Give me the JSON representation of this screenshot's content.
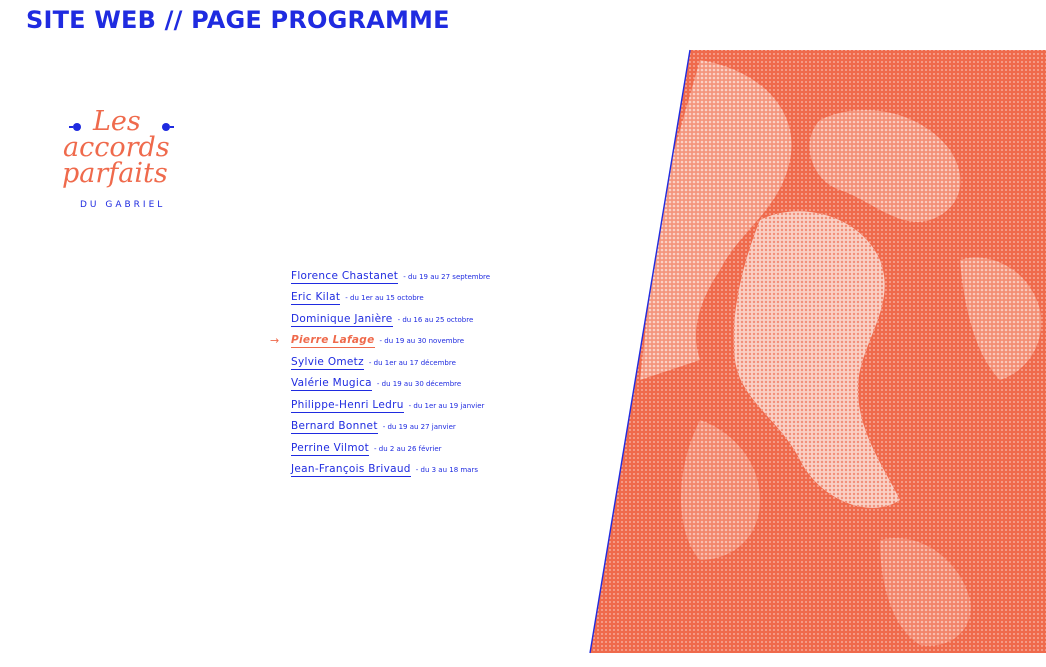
{
  "header": {
    "title": "SITE WEB // PAGE PROGRAMME"
  },
  "logo": {
    "line1": "Les",
    "line2": "accords",
    "line3": "parfaits",
    "subtitle": "DU GABRIEL"
  },
  "program": {
    "arrow": "→",
    "items": [
      {
        "name": "Florence Chastanet",
        "dates": "- du 19 au 27 septembre"
      },
      {
        "name": "Eric Kilat",
        "dates": "- du 1er au 15 octobre"
      },
      {
        "name": "Dominique Janière",
        "dates": "- du 16 au 25 octobre"
      },
      {
        "name": "Pierre Lafage",
        "dates": "- du 19 au 30 novembre"
      },
      {
        "name": "Sylvie Ometz",
        "dates": "- du 1er au 17 décembre"
      },
      {
        "name": "Valérie Mugica",
        "dates": "- du 19 au 30 décembre"
      },
      {
        "name": "Philippe-Henri Ledru",
        "dates": "- du 1er au 19 janvier"
      },
      {
        "name": "Bernard Bonnet",
        "dates": "- du 19 au 27 janvier"
      },
      {
        "name": "Perrine Vilmot",
        "dates": "- du 2 au 26 février"
      },
      {
        "name": "Jean-François Brivaud",
        "dates": "- du 3 au 18 mars"
      }
    ]
  },
  "colors": {
    "accent_blue": "#1f2be0",
    "accent_coral": "#ef6a4c"
  },
  "icons": {
    "arrow": "right-arrow-icon",
    "logo_ornament": "dot-ornament-icon"
  }
}
